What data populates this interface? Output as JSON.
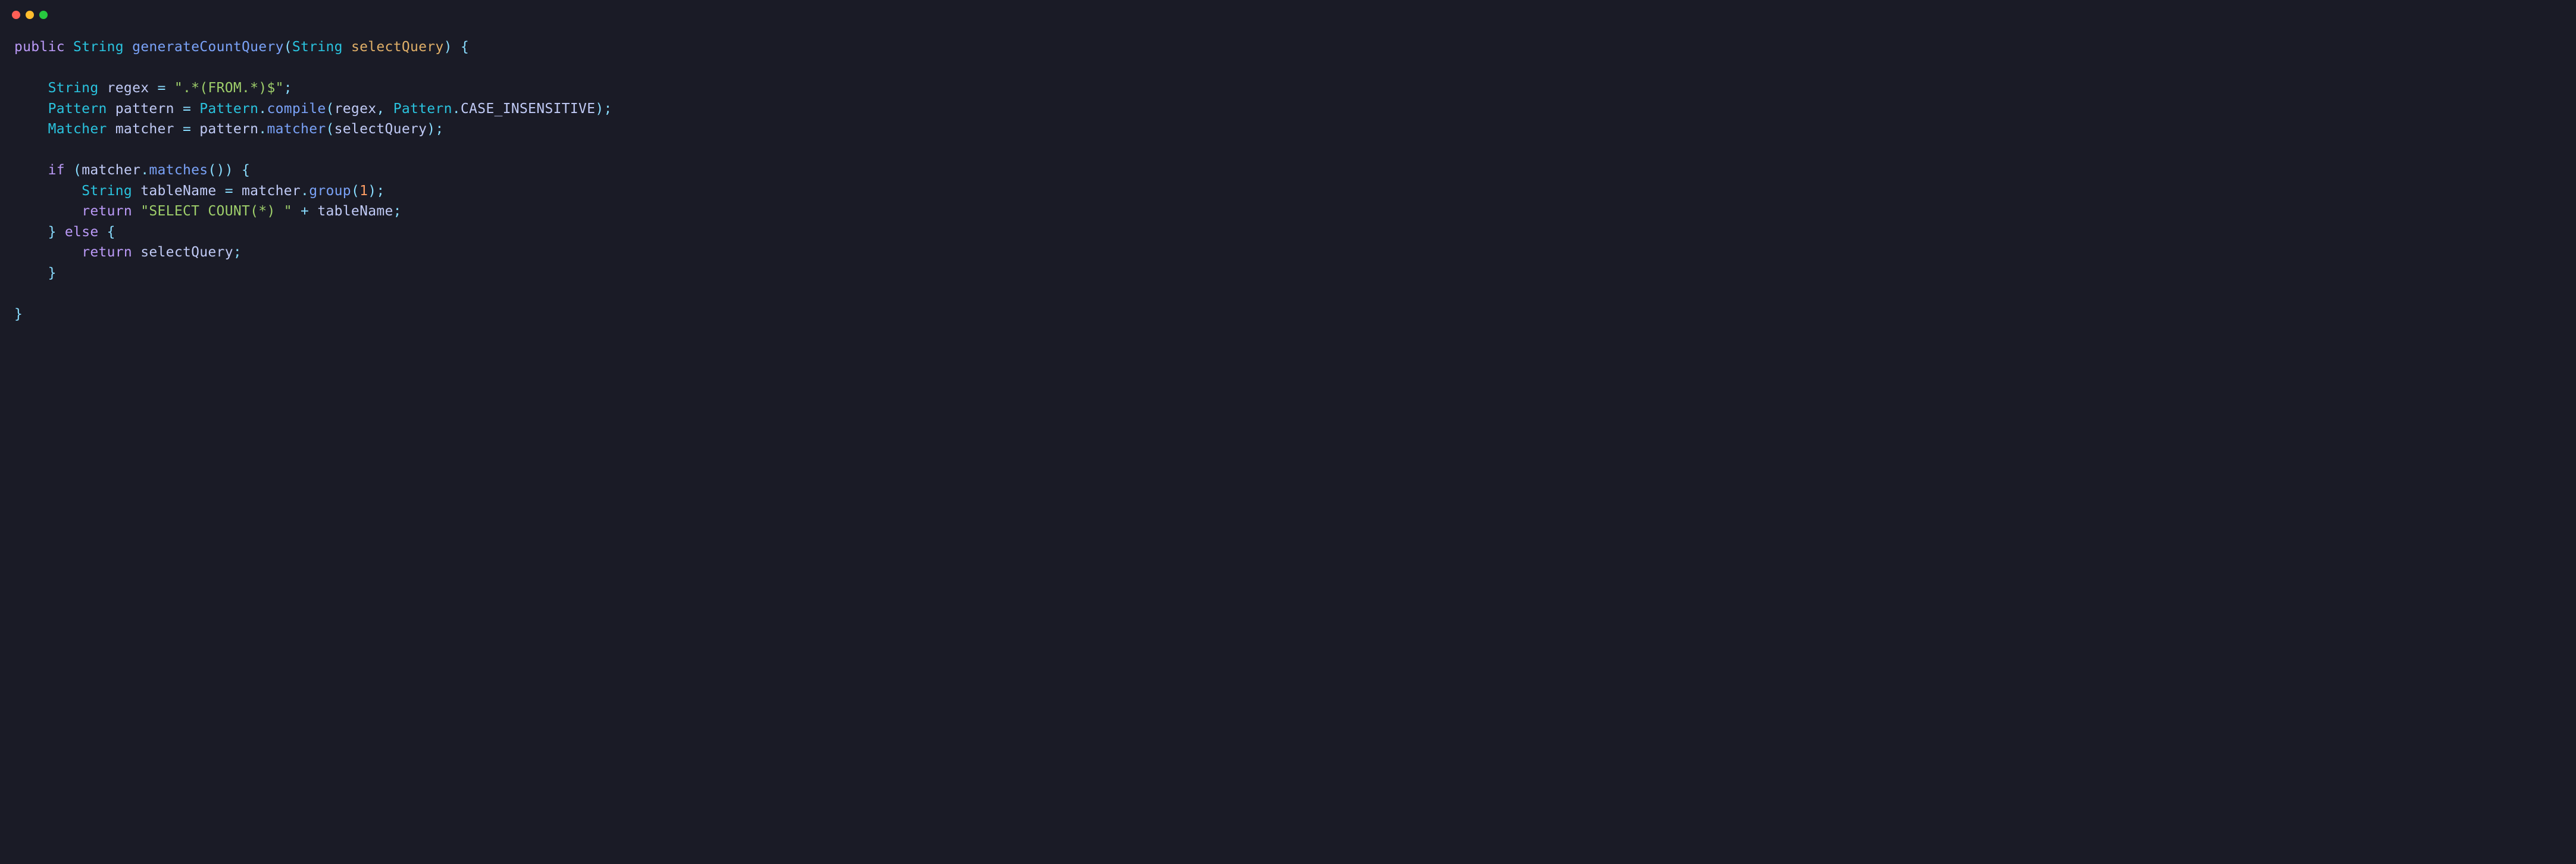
{
  "code": {
    "line1": {
      "kw_public": "public",
      "type_string": "String",
      "method": "generateCountQuery",
      "paren_open": "(",
      "param_type": "String",
      "param_name": "selectQuery",
      "paren_close": ")",
      "brace_open": " {"
    },
    "line3": {
      "indent": "    ",
      "type": "String",
      "var": "regex",
      "eq": " = ",
      "str": "\".*(FROM.*)$\"",
      "semi": ";"
    },
    "line4": {
      "indent": "    ",
      "type": "Pattern",
      "var": "pattern",
      "eq": " = ",
      "cls": "Pattern",
      "dot1": ".",
      "method": "compile",
      "paren_open": "(",
      "arg1": "regex",
      "comma": ", ",
      "cls2": "Pattern",
      "dot2": ".",
      "constant": "CASE_INSENSITIVE",
      "paren_close": ")",
      "semi": ";"
    },
    "line5": {
      "indent": "    ",
      "type": "Matcher",
      "var": "matcher",
      "eq": " = ",
      "obj": "pattern",
      "dot": ".",
      "method": "matcher",
      "paren_open": "(",
      "arg": "selectQuery",
      "paren_close": ")",
      "semi": ";"
    },
    "line7": {
      "indent": "    ",
      "kw_if": "if",
      "space": " ",
      "paren_open": "(",
      "obj": "matcher",
      "dot": ".",
      "method": "matches",
      "parens": "()",
      "paren_close": ")",
      "brace": " {"
    },
    "line8": {
      "indent": "        ",
      "type": "String",
      "var": "tableName",
      "eq": " = ",
      "obj": "matcher",
      "dot": ".",
      "method": "group",
      "paren_open": "(",
      "num": "1",
      "paren_close": ")",
      "semi": ";"
    },
    "line9": {
      "indent": "        ",
      "kw_return": "return",
      "space": " ",
      "str": "\"SELECT COUNT(*) \"",
      "plus": " + ",
      "var": "tableName",
      "semi": ";"
    },
    "line10": {
      "indent": "    ",
      "brace_close": "}",
      "space": " ",
      "kw_else": "else",
      "brace_open": " {"
    },
    "line11": {
      "indent": "        ",
      "kw_return": "return",
      "space": " ",
      "var": "selectQuery",
      "semi": ";"
    },
    "line12": {
      "indent": "    ",
      "brace": "}"
    },
    "line14": {
      "brace": "}"
    }
  }
}
